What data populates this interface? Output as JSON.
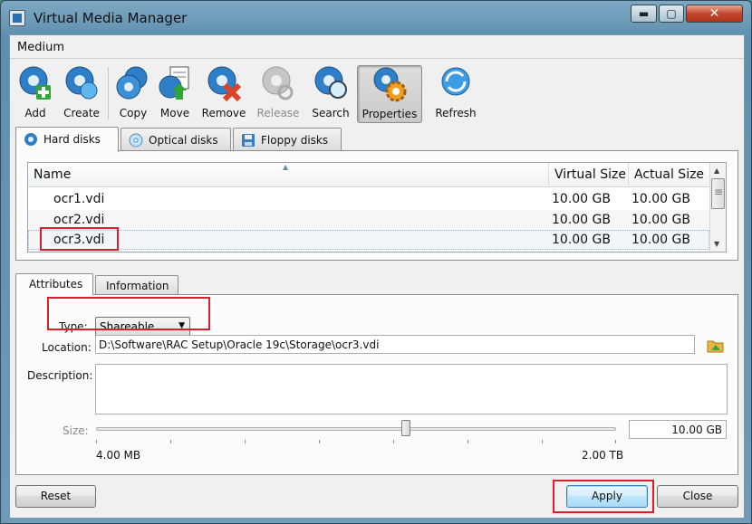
{
  "window": {
    "title": "Virtual Media Manager",
    "min_glyph": "▬",
    "max_glyph": "▢",
    "close_glyph": "✕"
  },
  "menu": {
    "medium": "Medium"
  },
  "toolbar": {
    "add": "Add",
    "create": "Create",
    "copy": "Copy",
    "move": "Move",
    "remove": "Remove",
    "release": "Release",
    "search": "Search",
    "properties": "Properties",
    "refresh": "Refresh"
  },
  "tabs": {
    "hard_disks": "Hard disks",
    "optical_disks": "Optical disks",
    "floppy_disks": "Floppy disks"
  },
  "table": {
    "columns": {
      "name": "Name",
      "virtual_size": "Virtual Size",
      "actual_size": "Actual Size"
    },
    "rows": [
      {
        "name": "ocr1.vdi",
        "virtual_size": "10.00 GB",
        "actual_size": "10.00 GB"
      },
      {
        "name": "ocr2.vdi",
        "virtual_size": "10.00 GB",
        "actual_size": "10.00 GB"
      },
      {
        "name": "ocr3.vdi",
        "virtual_size": "10.00 GB",
        "actual_size": "10.00 GB"
      }
    ],
    "sort_glyph": "▲",
    "scroll_up": "▲",
    "scroll_down": "▼"
  },
  "detail_tabs": {
    "attributes": "Attributes",
    "information": "Information"
  },
  "attributes": {
    "type_label": "Type:",
    "type_value": "Shareable",
    "type_arrow": "▼",
    "location_label": "Location:",
    "location_value": "D:\\Software\\RAC Setup\\Oracle 19c\\Storage\\ocr3.vdi",
    "description_label": "Description:",
    "description_value": "",
    "size_label": "Size:",
    "size_value": "10.00 GB",
    "size_min": "4.00 MB",
    "size_max": "2.00 TB"
  },
  "buttons": {
    "reset": "Reset",
    "apply": "Apply",
    "close": "Close"
  },
  "colors": {
    "highlight": "#d8202a",
    "accent": "#2c7fc9"
  }
}
